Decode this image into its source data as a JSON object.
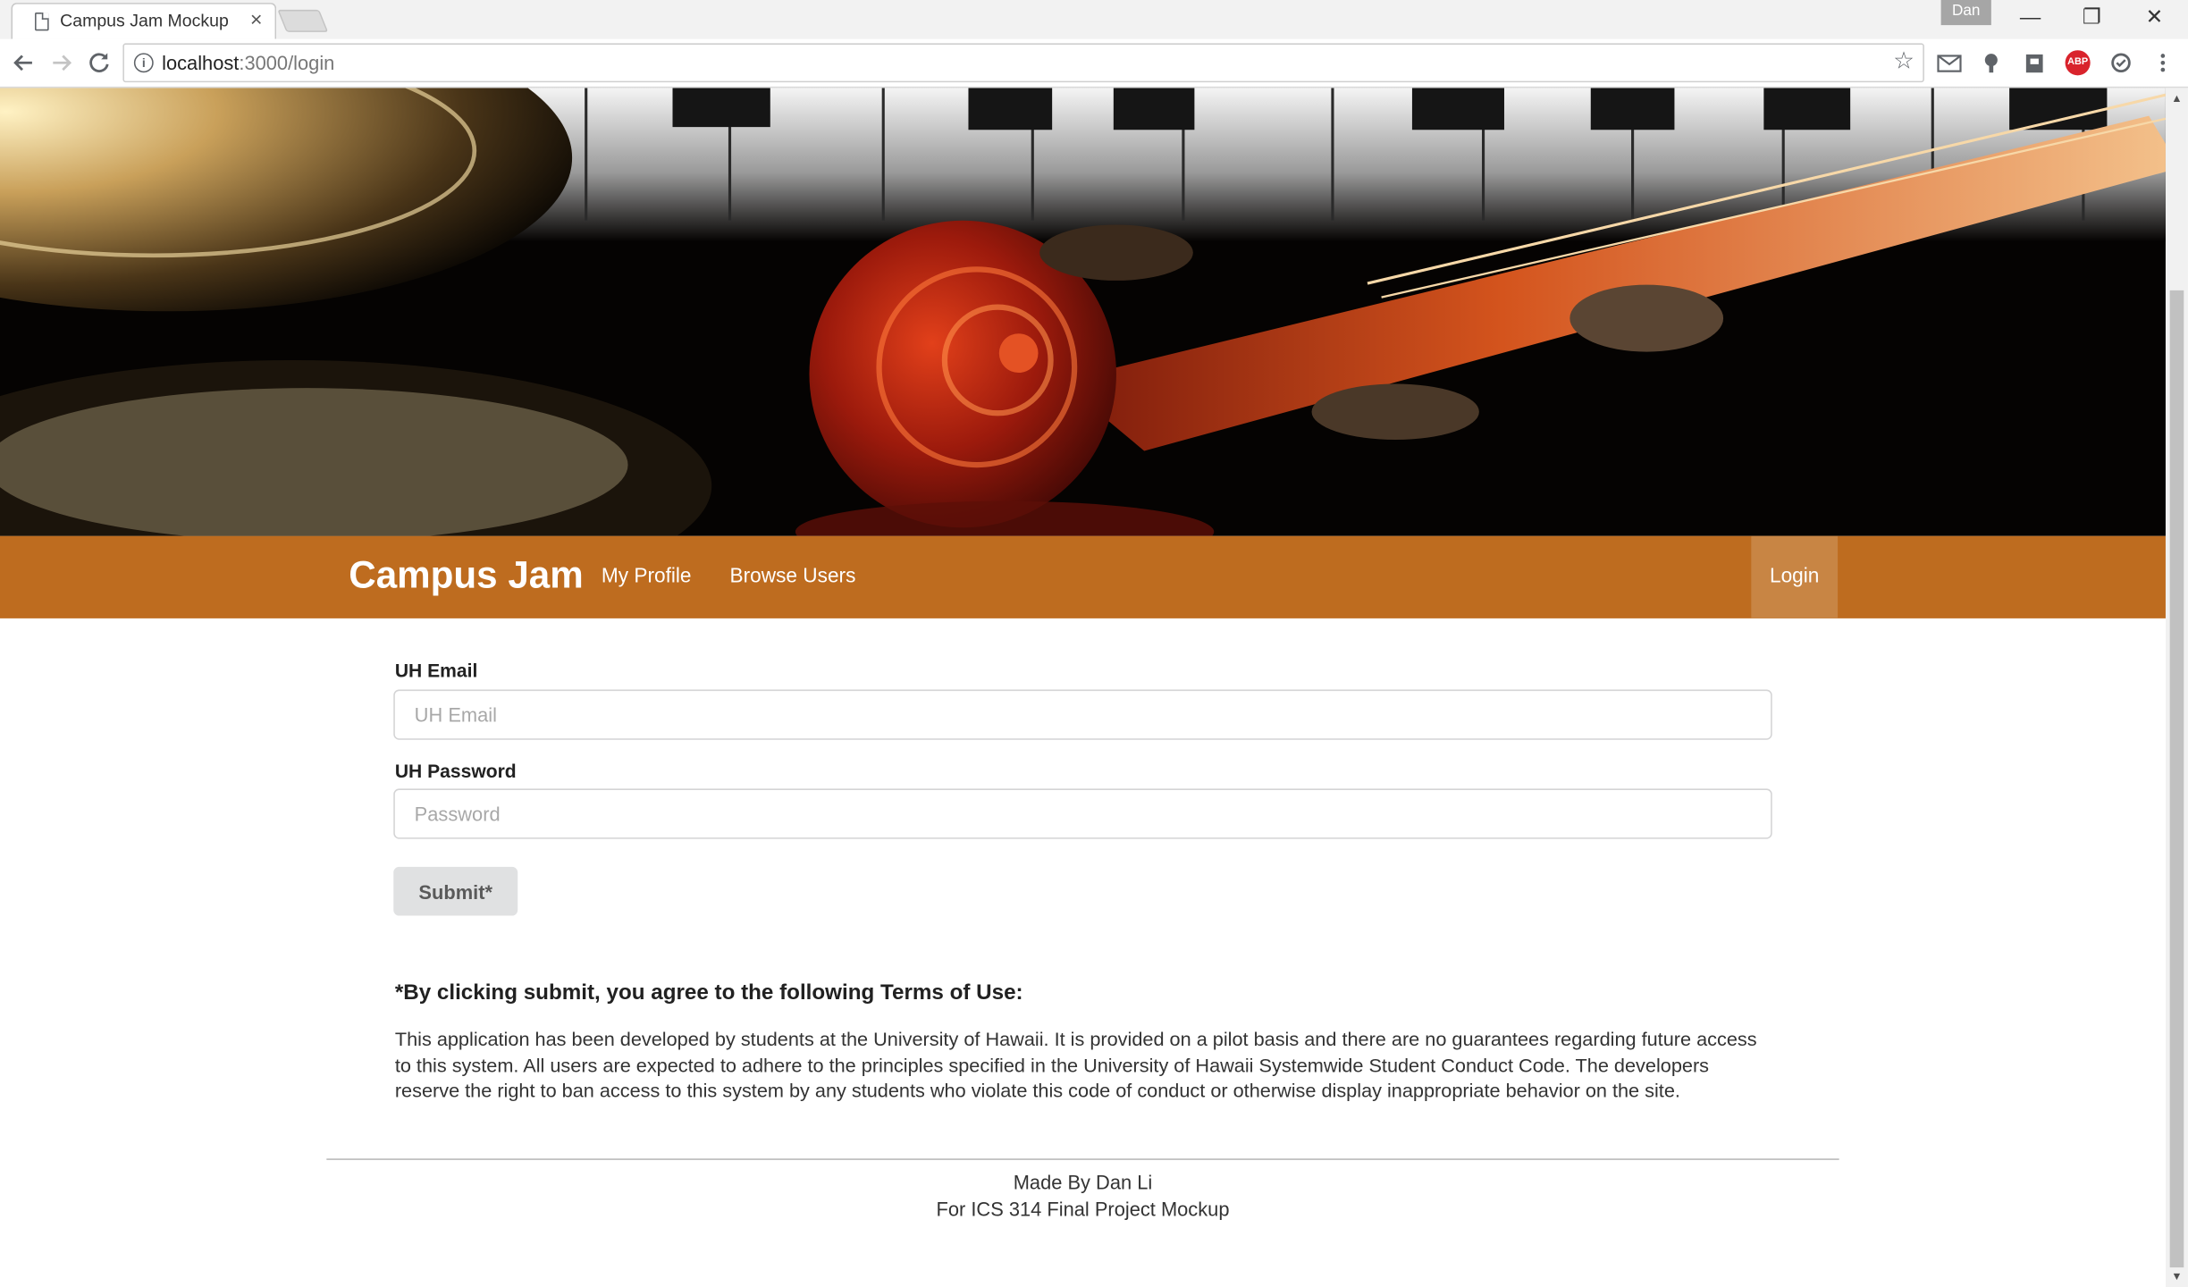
{
  "browser": {
    "tab_title": "Campus Jam Mockup",
    "tab_close": "×",
    "profile_name": "Dan",
    "url_host": "localhost",
    "url_rest": ":3000/login",
    "window_controls": {
      "minimize": "—",
      "restore": "❐",
      "close": "✕"
    }
  },
  "navbar": {
    "brand": "Campus Jam",
    "links": [
      "My Profile",
      "Browse Users"
    ],
    "login": "Login",
    "color": "#be6c1f"
  },
  "form": {
    "email_label": "UH Email",
    "email_placeholder": "UH Email",
    "password_label": "UH Password",
    "password_placeholder": "Password",
    "submit_label": "Submit*"
  },
  "terms": {
    "heading": "*By clicking submit, you agree to the following Terms of Use:",
    "body": "This application has been developed by students at the University of Hawaii. It is provided on a pilot basis and there are no guarantees regarding future access to this system. All users are expected to adhere to the principles specified in the University of Hawaii Systemwide Student Conduct Code. The developers reserve the right to ban access to this system by any students who violate this code of conduct or otherwise display inappropriate behavior on the site."
  },
  "footer": {
    "line1": "Made By Dan Li",
    "line2": "For ICS 314 Final Project Mockup"
  },
  "icons": [
    "document-icon",
    "back-icon",
    "forward-icon",
    "reload-icon",
    "info-icon",
    "star-icon",
    "gmail-icon",
    "lastpass-icon",
    "extension-icon",
    "adblock-icon",
    "sync-icon",
    "menu-icon"
  ]
}
